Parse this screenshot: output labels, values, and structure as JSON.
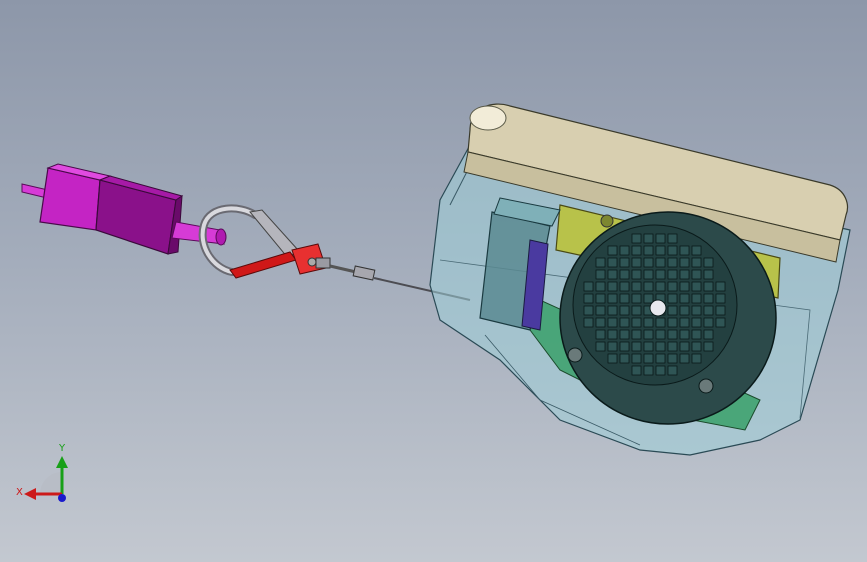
{
  "triad": {
    "x_label": "X",
    "y_label": "Y",
    "x_color": "#cc1a1a",
    "y_color": "#18a018",
    "z_color": "#1a1acc"
  },
  "colors": {
    "background_top": "#8d97a9",
    "background_bottom": "#c3c8d0",
    "plug_body": "#b01ab0",
    "hook_latch": "#d01818",
    "housing_glass": "#9fd0d8",
    "lid": "#d8cfb0",
    "motor_plate": "#b8c24a",
    "fan_disc": "#2c4a4a",
    "green_pcb": "#3aa06a",
    "blue_part": "#4a3aa0"
  }
}
